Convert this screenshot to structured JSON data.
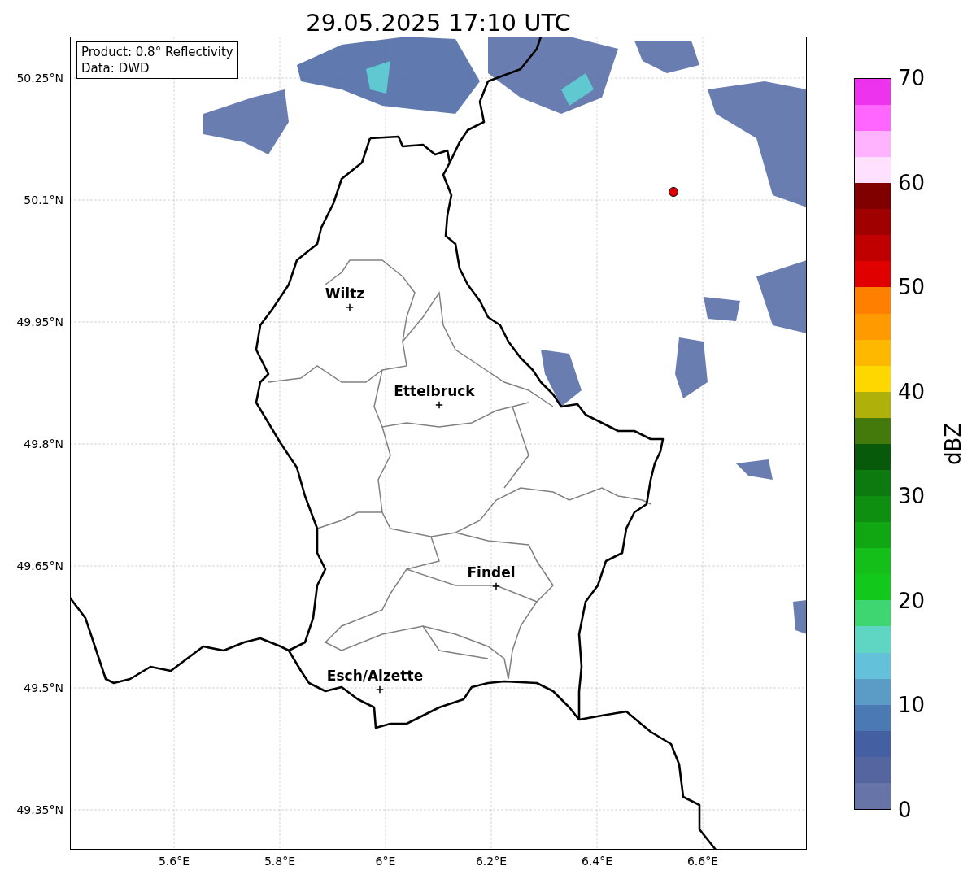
{
  "title": "29.05.2025 17:10 UTC",
  "info_box": {
    "lines": [
      "Product: 0.8° Reflectivity",
      "Data: DWD"
    ]
  },
  "lat_ticks": [
    "50.25°N",
    "50.1°N",
    "49.95°N",
    "49.8°N",
    "49.65°N",
    "49.5°N",
    "49.35°N"
  ],
  "lon_ticks": [
    "5.6°E",
    "5.8°E",
    "6°E",
    "6.2°E",
    "6.4°E",
    "6.6°E"
  ],
  "places": [
    {
      "name": "Wiltz"
    },
    {
      "name": "Ettelbruck"
    },
    {
      "name": "Findel"
    },
    {
      "name": "Esch/Alzette"
    }
  ],
  "colorbar": {
    "label": "dBZ",
    "ticks": [
      "70",
      "60",
      "50",
      "40",
      "30",
      "20",
      "10",
      "0"
    ],
    "segments": [
      {
        "color": "#6674a8"
      },
      {
        "color": "#5565a0"
      },
      {
        "color": "#4560a2"
      },
      {
        "color": "#4a79b4"
      },
      {
        "color": "#5a9cc6"
      },
      {
        "color": "#63c2da"
      },
      {
        "color": "#5fd5c4"
      },
      {
        "color": "#3ed670"
      },
      {
        "color": "#12c91b"
      },
      {
        "color": "#14bf1a"
      },
      {
        "color": "#10a712"
      },
      {
        "color": "#0e8f10"
      },
      {
        "color": "#0c7a0e"
      },
      {
        "color": "#075a0a"
      },
      {
        "color": "#437a0b"
      },
      {
        "color": "#b0b00a"
      },
      {
        "color": "#ffd700"
      },
      {
        "color": "#ffb800"
      },
      {
        "color": "#ff9b00"
      },
      {
        "color": "#ff7f00"
      },
      {
        "color": "#e00000"
      },
      {
        "color": "#c00000"
      },
      {
        "color": "#a00000"
      },
      {
        "color": "#800000"
      },
      {
        "color": "#ffe0ff"
      },
      {
        "color": "#ffb3ff"
      },
      {
        "color": "#ff66ff"
      },
      {
        "color": "#ee33ee"
      }
    ]
  }
}
